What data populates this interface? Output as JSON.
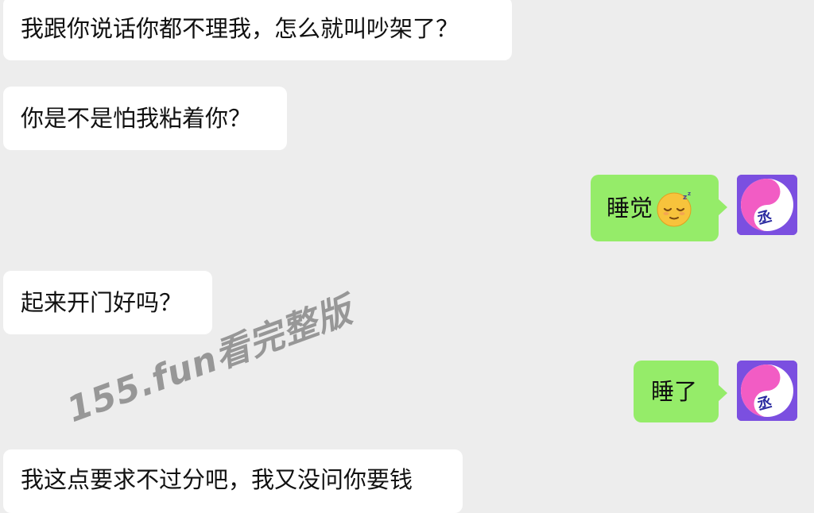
{
  "messages": [
    {
      "side": "incoming",
      "text": "我跟你说话你都不理我，怎么就叫吵架了？"
    },
    {
      "side": "incoming",
      "text": "你是不是怕我粘着你？"
    },
    {
      "side": "outgoing",
      "text": "睡觉",
      "emoji": "sleeping-face-emoji"
    },
    {
      "side": "incoming",
      "text": "起来开门好吗？"
    },
    {
      "side": "outgoing",
      "text": "睡了"
    },
    {
      "side": "incoming",
      "text": "我这点要求不过分吧，我又没问你要钱"
    }
  ],
  "watermark": "155.fun看完整版",
  "colors": {
    "background": "#ededed",
    "incoming_bubble": "#ffffff",
    "outgoing_bubble": "#95ec69",
    "avatar_bg": "#7b4fe0",
    "avatar_accent": "#f25cc4"
  }
}
